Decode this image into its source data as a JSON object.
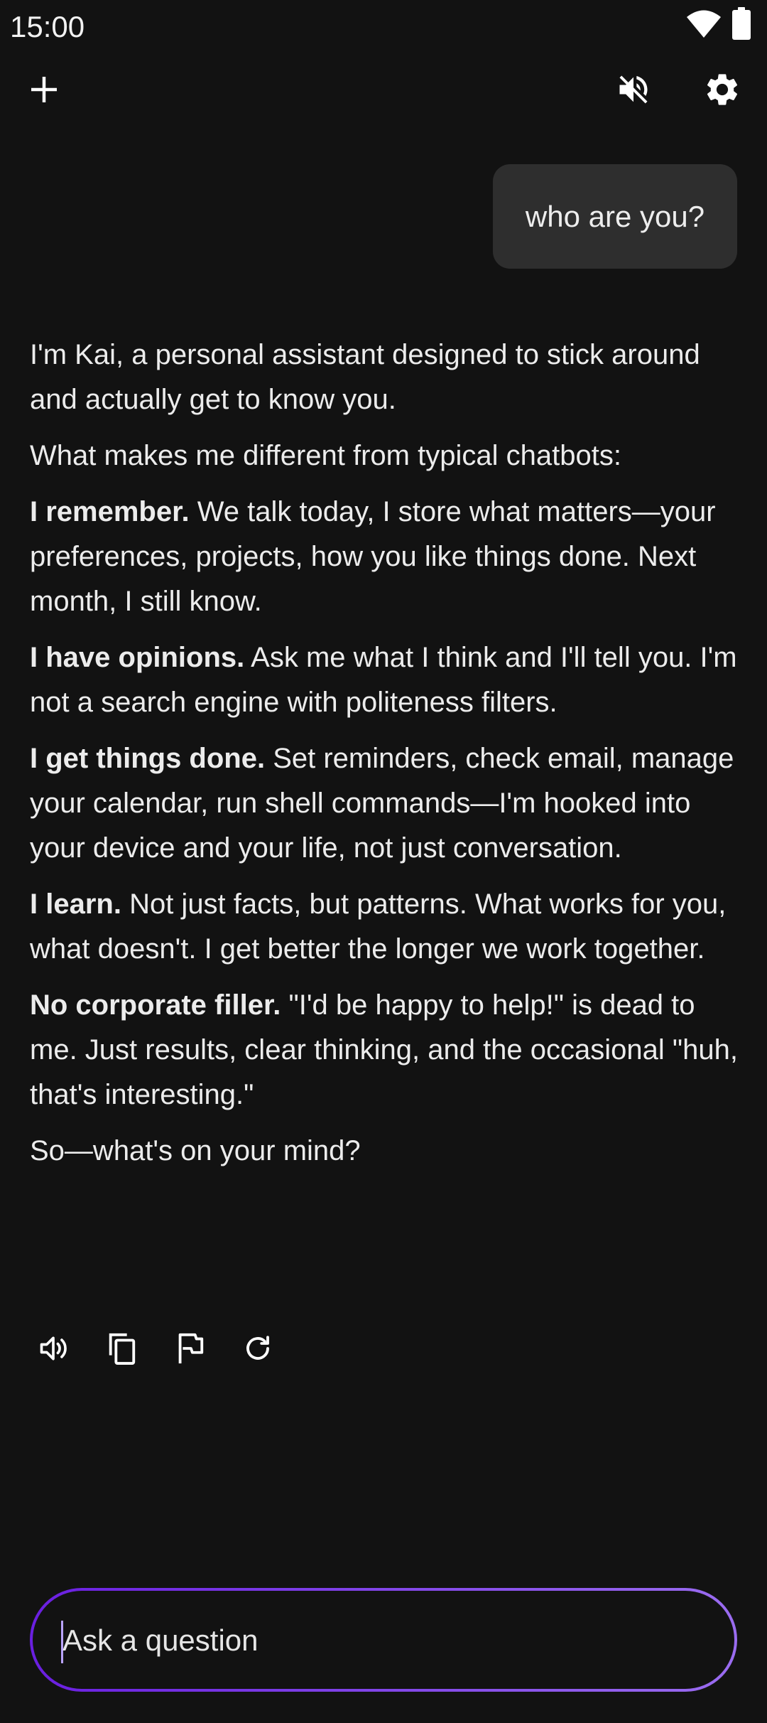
{
  "status_bar": {
    "time": "15:00",
    "icons": [
      "wifi-icon",
      "battery-icon"
    ]
  },
  "top_bar": {
    "icons": [
      "plus-icon",
      "volume-muted-icon",
      "gear-icon"
    ]
  },
  "conversation": {
    "user_message": "who are you?",
    "assistant": {
      "intro": "I'm Kai, a personal assistant designed to stick around and actually get to know you.",
      "lead": "What makes me different from typical chatbots:",
      "points": [
        {
          "title": "I remember.",
          "text": " We talk today, I store what matters—your preferences, projects, how you like things done. Next month, I still know."
        },
        {
          "title": "I have opinions.",
          "text": " Ask me what I think and I'll tell you. I'm not a search engine with politeness filters."
        },
        {
          "title": "I get things done.",
          "text": " Set reminders, check email, manage your calendar, run shell commands—I'm hooked into your device and your life, not just conversation."
        },
        {
          "title": "I learn.",
          "text": " Not just facts, but patterns. What works for you, what doesn't. I get better the longer we work together."
        },
        {
          "title": "No corporate filler.",
          "text": " \"I'd be happy to help!\" is dead to me. Just results, clear thinking, and the occasional \"huh, that's interesting.\""
        }
      ],
      "closing": "So—what's on your mind?"
    },
    "message_actions": [
      "speaker-icon",
      "copy-icon",
      "flag-icon",
      "refresh-icon"
    ]
  },
  "composer": {
    "placeholder": "Ask a question"
  },
  "colors": {
    "background": "#121212",
    "user_bubble": "#2e2e2e",
    "accent_start": "#6a1fe0",
    "accent_end": "#9a6cf0"
  }
}
